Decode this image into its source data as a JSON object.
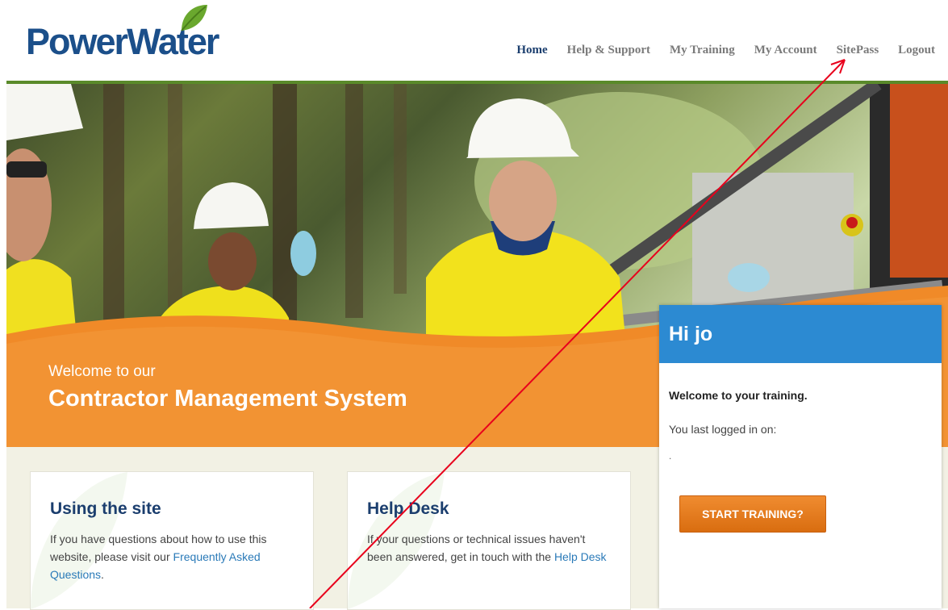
{
  "header": {
    "logo_text": "PowerWater",
    "nav": [
      {
        "label": "Home",
        "active": true
      },
      {
        "label": "Help & Support"
      },
      {
        "label": "My Training"
      },
      {
        "label": "My Account"
      },
      {
        "label": "SitePass"
      },
      {
        "label": "Logout"
      }
    ]
  },
  "hero": {
    "welcome_small": "Welcome to our",
    "welcome_large": "Contractor Management System"
  },
  "panel": {
    "greeting": "Hi jo",
    "welcome": "Welcome to your training.",
    "last_login": "You last logged in on:",
    "last_login_value": ".",
    "start_button": "START TRAINING?"
  },
  "cards": [
    {
      "title": "Using the site",
      "text_before": "If you have questions about how to use this website, please visit our ",
      "link": "Frequently Asked Questions",
      "text_after": "."
    },
    {
      "title": "Help Desk",
      "text_before": "If your questions or technical issues haven't been answered, get in touch with the ",
      "link": "Help Desk",
      "text_after": ""
    }
  ],
  "colors": {
    "brand_blue": "#1b4f8a",
    "accent_orange": "#f08c30",
    "panel_blue": "#2c8ad2",
    "divider_green": "#5a8a2a",
    "arrow_red": "#e8001c"
  }
}
